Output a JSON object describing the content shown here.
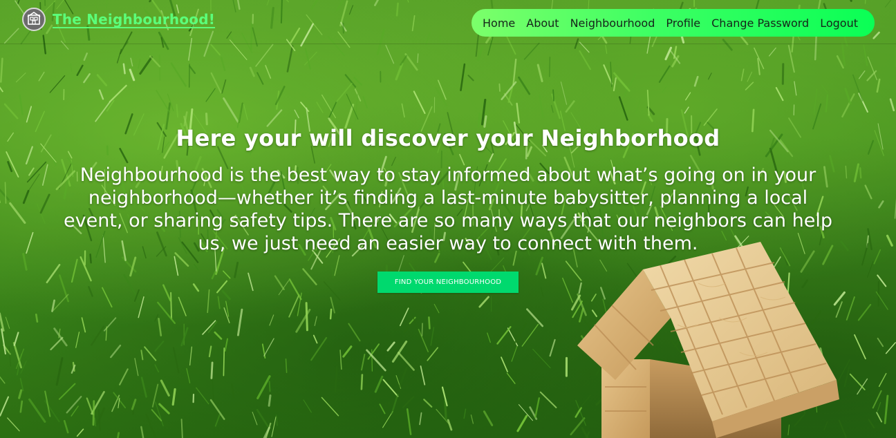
{
  "brand": {
    "name": "The Neighbourhood!",
    "logo_icon": "neighbourhood-logo-icon"
  },
  "nav": {
    "items": [
      {
        "label": "Home"
      },
      {
        "label": "About"
      },
      {
        "label": "Neighbourhood"
      },
      {
        "label": "Profile"
      },
      {
        "label": "Change Password"
      },
      {
        "label": "Logout"
      }
    ]
  },
  "hero": {
    "title": "Here your will discover your Neighborhood",
    "description": "Neighbourhood is the best way to stay informed about what’s going on in your neighborhood—whether it’s finding a last-minute babysitter, planning a local event, or sharing safety tips. There are so many ways that our neighbors can help us, we just need an easier way to connect with them.",
    "cta_label": "FIND YOUR NEIGHBOURHOOD"
  },
  "colors": {
    "brand_text": "#5bff7a",
    "nav_pill_start": "#7cff6a",
    "nav_pill_end": "#0aff55",
    "cta_background": "#00d96e",
    "hero_text": "#ffffff"
  }
}
